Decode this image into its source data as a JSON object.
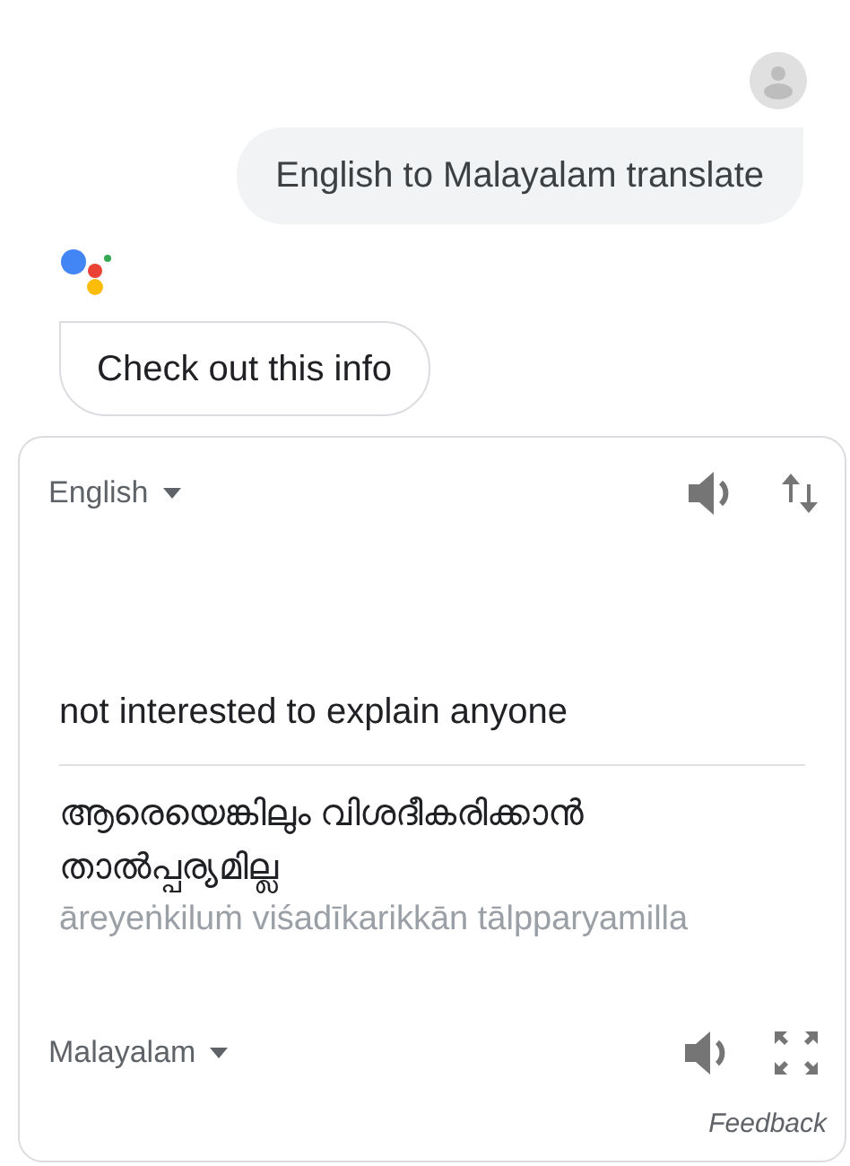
{
  "user_message": {
    "text": "English to Malayalam translate"
  },
  "assistant_message": {
    "text": "Check out this info"
  },
  "translate_card": {
    "source": {
      "language": "English",
      "text": "not interested to explain anyone"
    },
    "target": {
      "language": "Malayalam",
      "text": "ആരെയെങ്കിലും വിശദീകരിക്കാൻ താൽപ്പര്യമില്ല",
      "transliteration": "āreyeṅkiluṁ viśadīkarikkān tālpparyamilla"
    },
    "feedback": "Feedback"
  }
}
